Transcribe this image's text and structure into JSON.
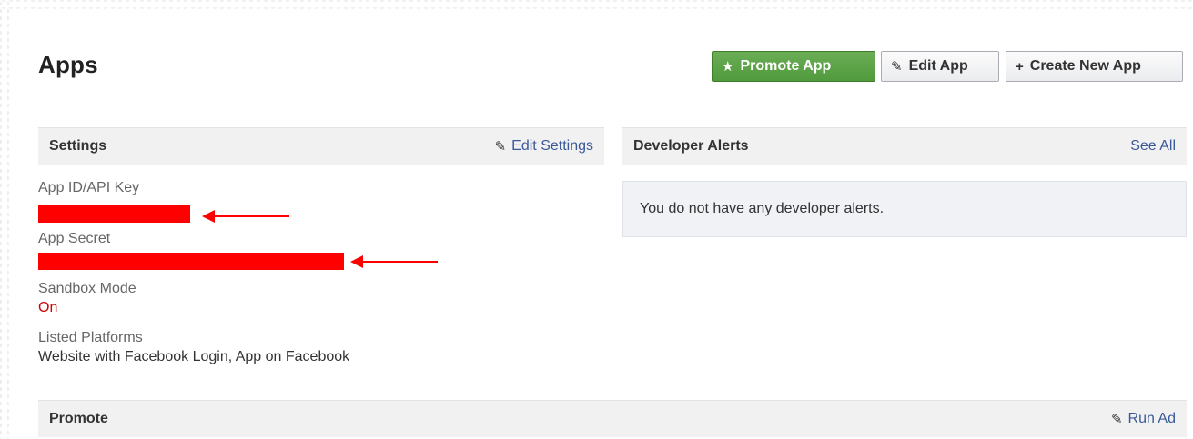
{
  "page": {
    "title": "Apps"
  },
  "toolbar": {
    "promote_label": "Promote App",
    "promote_icon": "star-icon",
    "edit_label": "Edit App",
    "edit_icon": "pencil-icon",
    "create_label": "Create New App",
    "create_icon": "plus-icon",
    "promote_color": "#5aa244"
  },
  "settings": {
    "title": "Settings",
    "edit_link": "Edit Settings",
    "fields": {
      "app_id_label": "App ID/API Key",
      "app_secret_label": "App Secret",
      "sandbox_label": "Sandbox Mode",
      "sandbox_value": "On",
      "platforms_label": "Listed Platforms",
      "platforms_value": "Website with Facebook Login, App on Facebook"
    },
    "redaction_color": "#ff0000"
  },
  "alerts": {
    "title": "Developer Alerts",
    "see_all": "See All",
    "empty_message": "You do not have any developer alerts."
  },
  "promote": {
    "title": "Promote",
    "run_ad": "Run Ad"
  },
  "colors": {
    "link": "#3b5998",
    "accent_red": "#d20000"
  }
}
